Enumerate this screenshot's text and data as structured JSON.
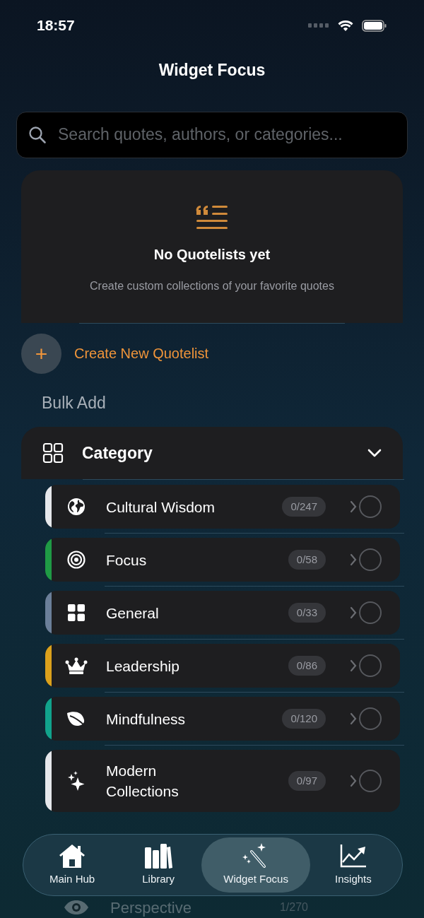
{
  "status_bar": {
    "time": "18:57"
  },
  "header": {
    "title": "Widget Focus"
  },
  "search": {
    "placeholder": "Search quotes, authors, or categories..."
  },
  "empty_state": {
    "title": "No Quotelists yet",
    "subtitle": "Create custom collections of your favorite quotes"
  },
  "create_button": {
    "icon": "+",
    "label": "Create New Quotelist"
  },
  "bulk_add": {
    "heading": "Bulk Add",
    "section": {
      "title": "Category",
      "expanded": true
    }
  },
  "categories": [
    {
      "label": "Cultural Wisdom",
      "count": "0/247",
      "color": "#e5e7eb",
      "checked": false
    },
    {
      "label": "Focus",
      "count": "0/58",
      "color": "#1f9a45",
      "checked": false
    },
    {
      "label": "General",
      "count": "0/33",
      "color": "#6b7f99",
      "checked": false
    },
    {
      "label": "Leadership",
      "count": "0/86",
      "color": "#dba11c",
      "checked": false
    },
    {
      "label": "Mindfulness",
      "count": "0/120",
      "color": "#11a38c",
      "checked": false
    },
    {
      "label": "Modern Collections",
      "count": "0/97",
      "color": "#e5e7eb",
      "checked": false
    }
  ],
  "partial_row": {
    "label": "Perspective",
    "count": "1/270"
  },
  "tab_bar": [
    {
      "label": "Main Hub",
      "selected": false
    },
    {
      "label": "Library",
      "selected": false
    },
    {
      "label": "Widget Focus",
      "selected": true
    },
    {
      "label": "Insights",
      "selected": false
    }
  ]
}
